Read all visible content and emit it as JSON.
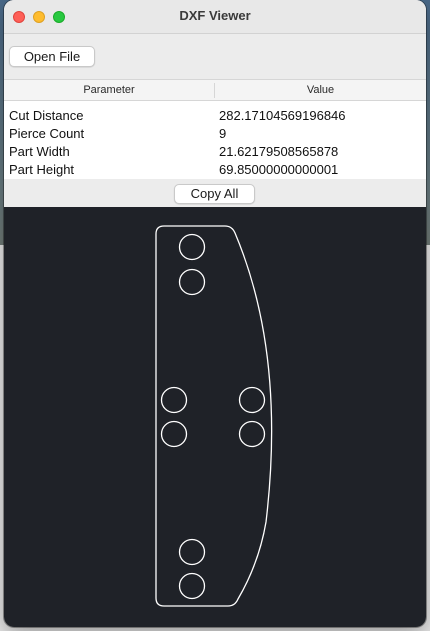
{
  "window": {
    "title": "DXF Viewer"
  },
  "toolbar": {
    "open_label": "Open File"
  },
  "table": {
    "headers": [
      "Parameter",
      "Value"
    ],
    "rows": [
      {
        "parameter": "Cut Distance",
        "value": "282.17104569196846"
      },
      {
        "parameter": "Pierce Count",
        "value": "9"
      },
      {
        "parameter": "Part Width",
        "value": "21.62179508565878"
      },
      {
        "parameter": "Part Height",
        "value": "69.85000000000001"
      }
    ]
  },
  "actions": {
    "copy_label": "Copy All"
  },
  "colors": {
    "canvas_background": "#1f2228",
    "outline": "#ffffff",
    "close": "#fe5f57",
    "minimize": "#febc2e",
    "maximize": "#28c840"
  }
}
